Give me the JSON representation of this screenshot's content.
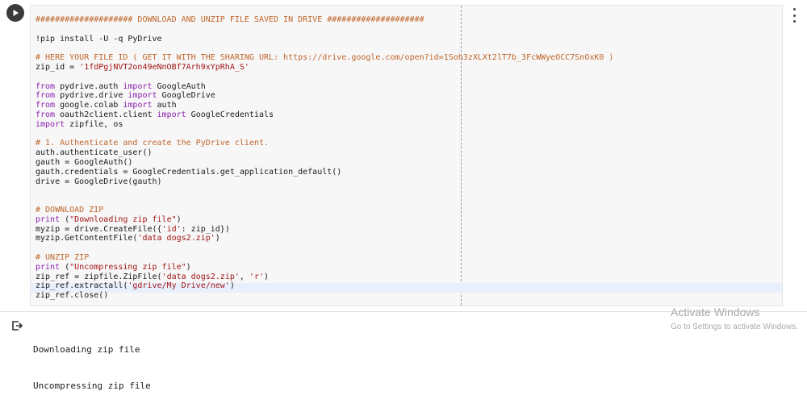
{
  "cell": {
    "run_button_icon": "play-icon",
    "menu_icon": "more-vert-icon",
    "code_lines": [
      [
        {
          "t": "#################### DOWNLOAD AND UNZIP FILE SAVED IN DRIVE ####################",
          "c": "comment"
        }
      ],
      [],
      [
        {
          "t": "!pip install -U -q PyDrive",
          "c": "plain"
        }
      ],
      [],
      [
        {
          "t": "# HERE YOUR FILE ID ( GET IT WITH THE SHARING URL: https://drive.google.com/open?id=1Soh3zXLXt2lT7b_3FcWWyeOCC7SnOxK0 )",
          "c": "comment"
        }
      ],
      [
        {
          "t": "zip_id = ",
          "c": "plain"
        },
        {
          "t": "'1fdPgjNVT2on49eNnOBf7Arh9xYpRhA_S'",
          "c": "str"
        }
      ],
      [],
      [
        {
          "t": "from",
          "c": "kw"
        },
        {
          "t": " pydrive.auth ",
          "c": "plain"
        },
        {
          "t": "import",
          "c": "kw"
        },
        {
          "t": " GoogleAuth",
          "c": "plain"
        }
      ],
      [
        {
          "t": "from",
          "c": "kw"
        },
        {
          "t": " pydrive.drive ",
          "c": "plain"
        },
        {
          "t": "import",
          "c": "kw"
        },
        {
          "t": " GoogleDrive",
          "c": "plain"
        }
      ],
      [
        {
          "t": "from",
          "c": "kw"
        },
        {
          "t": " google.colab ",
          "c": "plain"
        },
        {
          "t": "import",
          "c": "kw"
        },
        {
          "t": " auth",
          "c": "plain"
        }
      ],
      [
        {
          "t": "from",
          "c": "kw"
        },
        {
          "t": " oauth2client.client ",
          "c": "plain"
        },
        {
          "t": "import",
          "c": "kw"
        },
        {
          "t": " GoogleCredentials",
          "c": "plain"
        }
      ],
      [
        {
          "t": "import",
          "c": "kw"
        },
        {
          "t": " zipfile, os",
          "c": "plain"
        }
      ],
      [],
      [
        {
          "t": "# 1. Authenticate and create the PyDrive client.",
          "c": "comment"
        }
      ],
      [
        {
          "t": "auth.authenticate_user()",
          "c": "plain"
        }
      ],
      [
        {
          "t": "gauth = GoogleAuth()",
          "c": "plain"
        }
      ],
      [
        {
          "t": "gauth.credentials = GoogleCredentials.get_application_default()",
          "c": "plain"
        }
      ],
      [
        {
          "t": "drive = GoogleDrive(gauth)",
          "c": "plain"
        }
      ],
      [],
      [],
      [
        {
          "t": "# DOWNLOAD ZIP",
          "c": "comment"
        }
      ],
      [
        {
          "t": "print",
          "c": "kw"
        },
        {
          "t": " (",
          "c": "plain"
        },
        {
          "t": "\"Downloading zip file\"",
          "c": "str"
        },
        {
          "t": ")",
          "c": "plain"
        }
      ],
      [
        {
          "t": "myzip = drive.CreateFile({",
          "c": "plain"
        },
        {
          "t": "'id'",
          "c": "str"
        },
        {
          "t": ": zip_id})",
          "c": "plain"
        }
      ],
      [
        {
          "t": "myzip.GetContentFile(",
          "c": "plain"
        },
        {
          "t": "'data dogs2.zip'",
          "c": "str"
        },
        {
          "t": ")",
          "c": "plain"
        }
      ],
      [],
      [
        {
          "t": "# UNZIP ZIP",
          "c": "comment"
        }
      ],
      [
        {
          "t": "print",
          "c": "kw"
        },
        {
          "t": " (",
          "c": "plain"
        },
        {
          "t": "\"Uncompressing zip file\"",
          "c": "str"
        },
        {
          "t": ")",
          "c": "plain"
        }
      ],
      [
        {
          "t": "zip_ref = zipfile.ZipFile(",
          "c": "plain"
        },
        {
          "t": "'data dogs2.zip'",
          "c": "str"
        },
        {
          "t": ", ",
          "c": "plain"
        },
        {
          "t": "'r'",
          "c": "str"
        },
        {
          "t": ")",
          "c": "plain"
        }
      ],
      [
        {
          "t": "zip_ref.extractall(",
          "c": "plain"
        },
        {
          "t": "'gdrive/My Drive/new'",
          "c": "str"
        },
        {
          "t": ")",
          "c": "plain"
        }
      ],
      [
        {
          "t": "zip_ref.close()",
          "c": "plain"
        }
      ]
    ]
  },
  "output": {
    "icon": "output-redirect-icon",
    "lines": [
      "Downloading zip file",
      "Uncompressing zip file"
    ]
  },
  "watermark": {
    "title": "Activate Windows",
    "subtitle": "Go to Settings to activate Windows."
  },
  "colors": {
    "comment": "#c0652a",
    "keyword": "#8a1eae",
    "string": "#a31515",
    "editor_bg": "#f7f7f7"
  }
}
